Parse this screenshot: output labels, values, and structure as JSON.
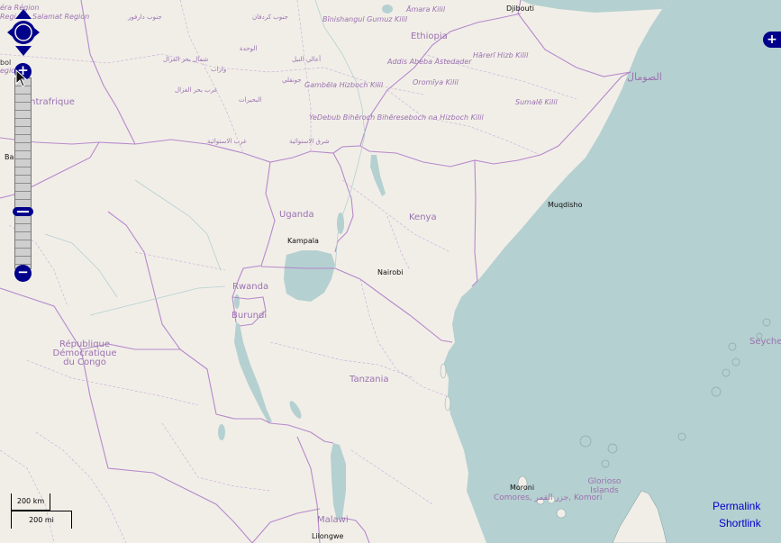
{
  "countries": [
    {
      "id": "ethiopia",
      "text": "Ethiopia"
    },
    {
      "id": "uganda",
      "text": "Uganda"
    },
    {
      "id": "kenya",
      "text": "Kenya"
    },
    {
      "id": "rwanda",
      "text": "Rwanda"
    },
    {
      "id": "burundi",
      "text": "Burundi"
    },
    {
      "id": "drc",
      "text": "République Démocratique du Congo"
    },
    {
      "id": "tanzania",
      "text": "Tanzania"
    },
    {
      "id": "malawi",
      "text": "Malawi"
    },
    {
      "id": "somalia",
      "text": "الصومال"
    },
    {
      "id": "car",
      "text": "Centrafrique"
    },
    {
      "id": "glorioso",
      "text": "Glorioso Islands"
    },
    {
      "id": "comores",
      "text": "Comores, جزر القمر, Komori"
    },
    {
      "id": "seychelles",
      "text": "Seyche"
    }
  ],
  "regions": [
    {
      "id": "amara",
      "text": "Āmara Kilil"
    },
    {
      "id": "benishangul",
      "text": "Bīnishangul Gumuz Kilil"
    },
    {
      "id": "addis",
      "text": "Addis Abeba Astedader"
    },
    {
      "id": "hareri",
      "text": "Hārerī Hizb Kilil"
    },
    {
      "id": "gambela",
      "text": "Gambēla Hizboch Kilil"
    },
    {
      "id": "oromiya",
      "text": "Oromīya Kilil"
    },
    {
      "id": "sumale",
      "text": "Sumalē Kilil"
    },
    {
      "id": "yedebub",
      "text": "YeDebub Bihēroch Bihēreseboch na Hizboch Kilil"
    },
    {
      "id": "salamat",
      "text": "Salamat Region"
    },
    {
      "id": "regi",
      "text": "Regi"
    },
    {
      "id": "era",
      "text": "éra Région"
    }
  ],
  "arabic_regions": [
    {
      "id": "ar1",
      "text": "جنوب دارفور"
    },
    {
      "id": "ar2",
      "text": "جنوب كردفان"
    },
    {
      "id": "ar3",
      "text": "الوحدة"
    },
    {
      "id": "ar4",
      "text": "شمال بحر الغزال"
    },
    {
      "id": "ar5",
      "text": "واراب"
    },
    {
      "id": "ar6",
      "text": "أعالي النيل"
    },
    {
      "id": "ar7",
      "text": "جونقلي"
    },
    {
      "id": "ar8",
      "text": "غرب بحر الغزال"
    },
    {
      "id": "ar9",
      "text": "البحيرات"
    },
    {
      "id": "ar10",
      "text": "غرب الاستوائية"
    },
    {
      "id": "ar11",
      "text": "شرق الاستوائية"
    }
  ],
  "cities": [
    {
      "id": "djibouti",
      "text": "Djibouti"
    },
    {
      "id": "muqdisho",
      "text": "Muqdisho"
    },
    {
      "id": "kampala",
      "text": "Kampala"
    },
    {
      "id": "nairobi",
      "text": "Nairobi"
    },
    {
      "id": "bangui",
      "text": "Bangui"
    },
    {
      "id": "moroni",
      "text": "Moroni"
    },
    {
      "id": "lilongwe",
      "text": "Lilongwe"
    },
    {
      "id": "bol",
      "text": "bol"
    },
    {
      "id": "regio",
      "text": "egio"
    }
  ],
  "controls": {
    "zoom_in": "+",
    "zoom_out": "−",
    "layer_switcher": "+",
    "pan_label": "pan"
  },
  "scale": {
    "km": "200 km",
    "mi": "200 mi"
  },
  "links": {
    "permalink": "Permalink",
    "shortlink": "Shortlink"
  },
  "colors": {
    "water": "#b5d0d0",
    "land": "#f1eee8",
    "border": "#b07dc8",
    "accent": "#00008b"
  }
}
